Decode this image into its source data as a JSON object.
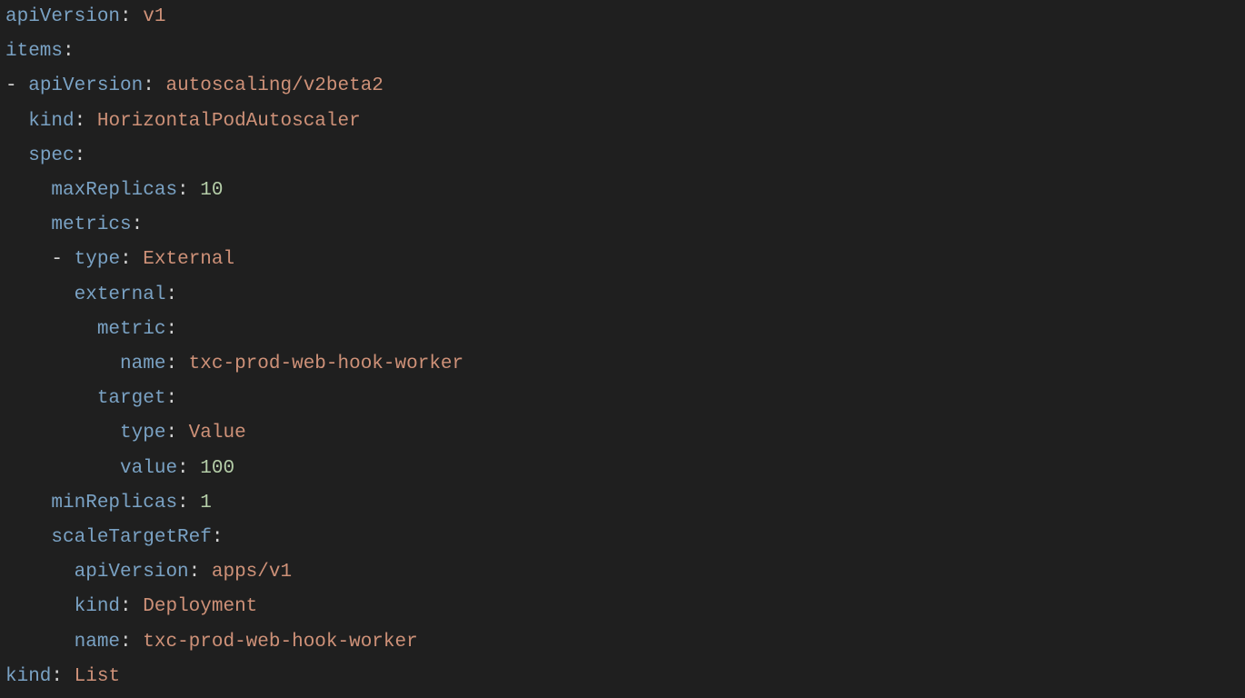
{
  "colon": ":",
  "dash": "-",
  "line1": {
    "k": "apiVersion",
    "v": "v1"
  },
  "line2": {
    "k": "items"
  },
  "line3": {
    "k": "apiVersion",
    "v": "autoscaling/v2beta2"
  },
  "line4": {
    "k": "kind",
    "v": "HorizontalPodAutoscaler"
  },
  "line5": {
    "k": "spec"
  },
  "line6": {
    "k": "maxReplicas",
    "v": "10"
  },
  "line7": {
    "k": "metrics"
  },
  "line8": {
    "k": "type",
    "v": "External"
  },
  "line9": {
    "k": "external"
  },
  "line10": {
    "k": "metric"
  },
  "line11": {
    "k": "name",
    "v": "txc-prod-web-hook-worker"
  },
  "line12": {
    "k": "target"
  },
  "line13": {
    "k": "type",
    "v": "Value"
  },
  "line14": {
    "k": "value",
    "v": "100"
  },
  "line15": {
    "k": "minReplicas",
    "v": "1"
  },
  "line16": {
    "k": "scaleTargetRef"
  },
  "line17": {
    "k": "apiVersion",
    "v": "apps/v1"
  },
  "line18": {
    "k": "kind",
    "v": "Deployment"
  },
  "line19": {
    "k": "name",
    "v": "txc-prod-web-hook-worker"
  },
  "line20": {
    "k": "kind",
    "v": "List"
  }
}
